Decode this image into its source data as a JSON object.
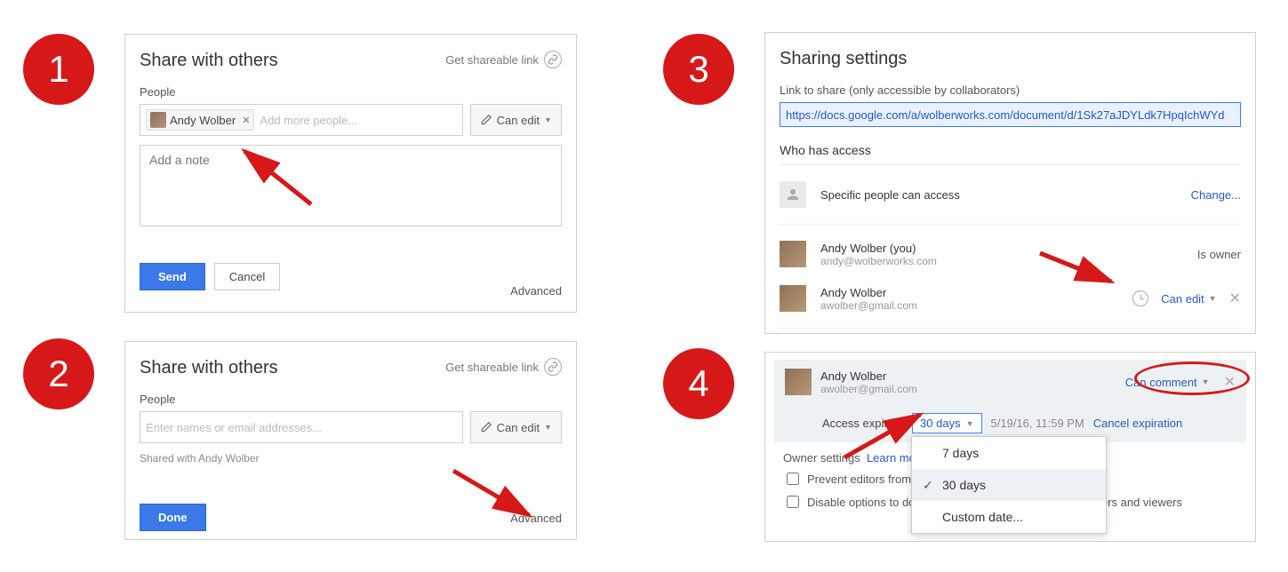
{
  "badges": {
    "n1": "1",
    "n2": "2",
    "n3": "3",
    "n4": "4"
  },
  "panel1": {
    "title": "Share with others",
    "get_link": "Get shareable link",
    "people_label": "People",
    "chip_name": "Andy Wolber",
    "add_more_placeholder": "Add more people...",
    "perm_label": "Can edit",
    "note_placeholder": "Add a note",
    "send": "Send",
    "cancel": "Cancel",
    "advanced": "Advanced"
  },
  "panel2": {
    "title": "Share with others",
    "get_link": "Get shareable link",
    "people_label": "People",
    "input_placeholder": "Enter names or email addresses...",
    "perm_label": "Can edit",
    "shared_with": "Shared with Andy Wolber",
    "done": "Done",
    "advanced": "Advanced"
  },
  "panel3": {
    "title": "Sharing settings",
    "link_label": "Link to share (only accessible by collaborators)",
    "link_url": "https://docs.google.com/a/wolberworks.com/document/d/1Sk27aJDYLdk7HpqIchWYd",
    "who_label": "Who has access",
    "row_access": "Specific people can access",
    "change": "Change...",
    "user_self_name": "Andy Wolber (you)",
    "user_self_email": "andy@wolberworks.com",
    "user_self_role": "Is owner",
    "user_other_name": "Andy Wolber",
    "user_other_email": "awolber@gmail.com",
    "user_other_perm": "Can edit"
  },
  "panel4": {
    "user_name": "Andy Wolber",
    "user_email": "awolber@gmail.com",
    "user_perm": "Can comment",
    "expires_label": "Access expires:",
    "expires_value": "30 days",
    "expires_date": "5/19/16, 11:59 PM",
    "cancel_expiration": "Cancel expiration",
    "menu": {
      "opt7": "7 days",
      "opt30": "30 days",
      "custom": "Custom date..."
    },
    "owner_settings": "Owner settings",
    "learn_more": "Learn more",
    "cb1": "Prevent editors from c",
    "cb2": "Disable options to download, print, and copy for commenters and viewers"
  }
}
